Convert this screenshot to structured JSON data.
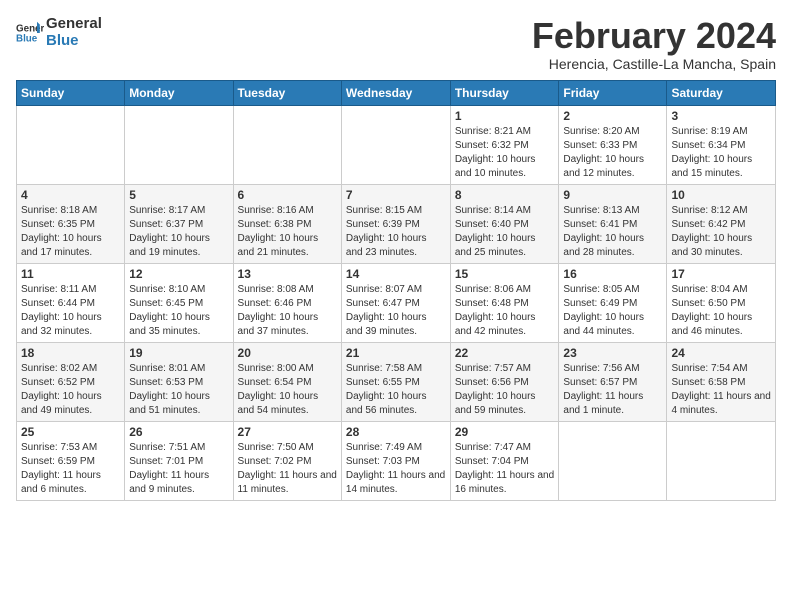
{
  "logo": {
    "text_general": "General",
    "text_blue": "Blue"
  },
  "header": {
    "month_year": "February 2024",
    "location": "Herencia, Castille-La Mancha, Spain"
  },
  "weekdays": [
    "Sunday",
    "Monday",
    "Tuesday",
    "Wednesday",
    "Thursday",
    "Friday",
    "Saturday"
  ],
  "weeks": [
    [
      {
        "day": "",
        "info": ""
      },
      {
        "day": "",
        "info": ""
      },
      {
        "day": "",
        "info": ""
      },
      {
        "day": "",
        "info": ""
      },
      {
        "day": "1",
        "info": "Sunrise: 8:21 AM\nSunset: 6:32 PM\nDaylight: 10 hours and 10 minutes."
      },
      {
        "day": "2",
        "info": "Sunrise: 8:20 AM\nSunset: 6:33 PM\nDaylight: 10 hours and 12 minutes."
      },
      {
        "day": "3",
        "info": "Sunrise: 8:19 AM\nSunset: 6:34 PM\nDaylight: 10 hours and 15 minutes."
      }
    ],
    [
      {
        "day": "4",
        "info": "Sunrise: 8:18 AM\nSunset: 6:35 PM\nDaylight: 10 hours and 17 minutes."
      },
      {
        "day": "5",
        "info": "Sunrise: 8:17 AM\nSunset: 6:37 PM\nDaylight: 10 hours and 19 minutes."
      },
      {
        "day": "6",
        "info": "Sunrise: 8:16 AM\nSunset: 6:38 PM\nDaylight: 10 hours and 21 minutes."
      },
      {
        "day": "7",
        "info": "Sunrise: 8:15 AM\nSunset: 6:39 PM\nDaylight: 10 hours and 23 minutes."
      },
      {
        "day": "8",
        "info": "Sunrise: 8:14 AM\nSunset: 6:40 PM\nDaylight: 10 hours and 25 minutes."
      },
      {
        "day": "9",
        "info": "Sunrise: 8:13 AM\nSunset: 6:41 PM\nDaylight: 10 hours and 28 minutes."
      },
      {
        "day": "10",
        "info": "Sunrise: 8:12 AM\nSunset: 6:42 PM\nDaylight: 10 hours and 30 minutes."
      }
    ],
    [
      {
        "day": "11",
        "info": "Sunrise: 8:11 AM\nSunset: 6:44 PM\nDaylight: 10 hours and 32 minutes."
      },
      {
        "day": "12",
        "info": "Sunrise: 8:10 AM\nSunset: 6:45 PM\nDaylight: 10 hours and 35 minutes."
      },
      {
        "day": "13",
        "info": "Sunrise: 8:08 AM\nSunset: 6:46 PM\nDaylight: 10 hours and 37 minutes."
      },
      {
        "day": "14",
        "info": "Sunrise: 8:07 AM\nSunset: 6:47 PM\nDaylight: 10 hours and 39 minutes."
      },
      {
        "day": "15",
        "info": "Sunrise: 8:06 AM\nSunset: 6:48 PM\nDaylight: 10 hours and 42 minutes."
      },
      {
        "day": "16",
        "info": "Sunrise: 8:05 AM\nSunset: 6:49 PM\nDaylight: 10 hours and 44 minutes."
      },
      {
        "day": "17",
        "info": "Sunrise: 8:04 AM\nSunset: 6:50 PM\nDaylight: 10 hours and 46 minutes."
      }
    ],
    [
      {
        "day": "18",
        "info": "Sunrise: 8:02 AM\nSunset: 6:52 PM\nDaylight: 10 hours and 49 minutes."
      },
      {
        "day": "19",
        "info": "Sunrise: 8:01 AM\nSunset: 6:53 PM\nDaylight: 10 hours and 51 minutes."
      },
      {
        "day": "20",
        "info": "Sunrise: 8:00 AM\nSunset: 6:54 PM\nDaylight: 10 hours and 54 minutes."
      },
      {
        "day": "21",
        "info": "Sunrise: 7:58 AM\nSunset: 6:55 PM\nDaylight: 10 hours and 56 minutes."
      },
      {
        "day": "22",
        "info": "Sunrise: 7:57 AM\nSunset: 6:56 PM\nDaylight: 10 hours and 59 minutes."
      },
      {
        "day": "23",
        "info": "Sunrise: 7:56 AM\nSunset: 6:57 PM\nDaylight: 11 hours and 1 minute."
      },
      {
        "day": "24",
        "info": "Sunrise: 7:54 AM\nSunset: 6:58 PM\nDaylight: 11 hours and 4 minutes."
      }
    ],
    [
      {
        "day": "25",
        "info": "Sunrise: 7:53 AM\nSunset: 6:59 PM\nDaylight: 11 hours and 6 minutes."
      },
      {
        "day": "26",
        "info": "Sunrise: 7:51 AM\nSunset: 7:01 PM\nDaylight: 11 hours and 9 minutes."
      },
      {
        "day": "27",
        "info": "Sunrise: 7:50 AM\nSunset: 7:02 PM\nDaylight: 11 hours and 11 minutes."
      },
      {
        "day": "28",
        "info": "Sunrise: 7:49 AM\nSunset: 7:03 PM\nDaylight: 11 hours and 14 minutes."
      },
      {
        "day": "29",
        "info": "Sunrise: 7:47 AM\nSunset: 7:04 PM\nDaylight: 11 hours and 16 minutes."
      },
      {
        "day": "",
        "info": ""
      },
      {
        "day": "",
        "info": ""
      }
    ]
  ]
}
